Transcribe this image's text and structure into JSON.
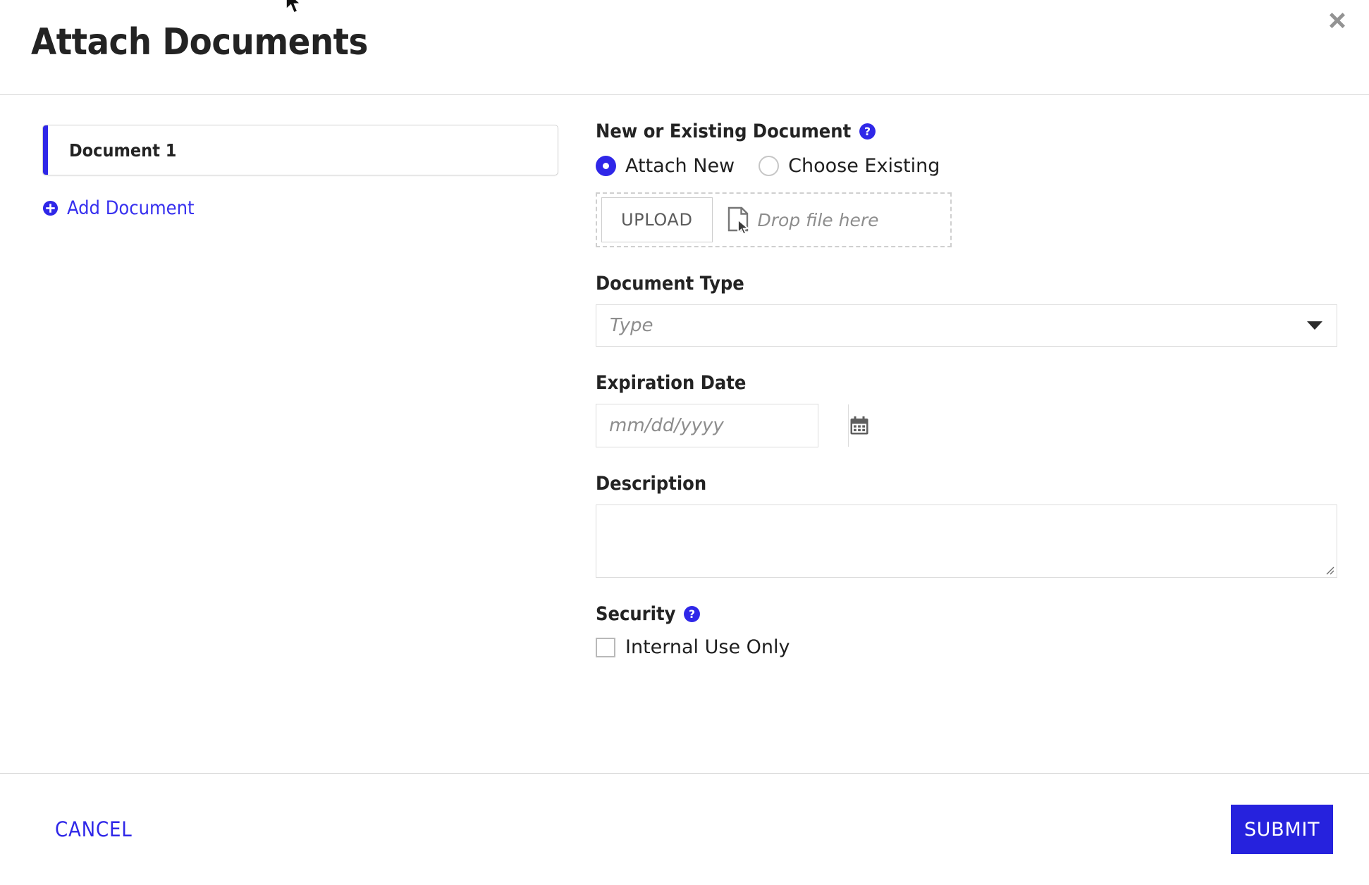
{
  "dialog": {
    "title": "Attach Documents",
    "close_label": "✖"
  },
  "left_pane": {
    "documents": [
      {
        "label": "Document 1"
      }
    ],
    "add_document_label": "Add Document"
  },
  "form": {
    "new_or_existing": {
      "label": "New or Existing Document",
      "help": "?",
      "options": [
        {
          "label": "Attach New",
          "selected": true
        },
        {
          "label": "Choose Existing",
          "selected": false
        }
      ]
    },
    "upload": {
      "button_label": "UPLOAD",
      "drop_hint": "Drop file here"
    },
    "document_type": {
      "label": "Document Type",
      "placeholder": "Type",
      "value": ""
    },
    "expiration_date": {
      "label": "Expiration Date",
      "placeholder": "mm/dd/yyyy",
      "value": ""
    },
    "description": {
      "label": "Description",
      "value": ""
    },
    "security": {
      "label": "Security",
      "help": "?",
      "checkbox_label": "Internal Use Only",
      "checked": false
    }
  },
  "footer": {
    "cancel_label": "CANCEL",
    "submit_label": "SUBMIT"
  },
  "colors": {
    "accent_blue": "#2f27e8",
    "submit_blue": "#2622dd",
    "link_blue": "#3730ef",
    "border_gray": "#dcdcdc",
    "text_dark": "#232323",
    "placeholder_gray": "#8d8d8d"
  }
}
